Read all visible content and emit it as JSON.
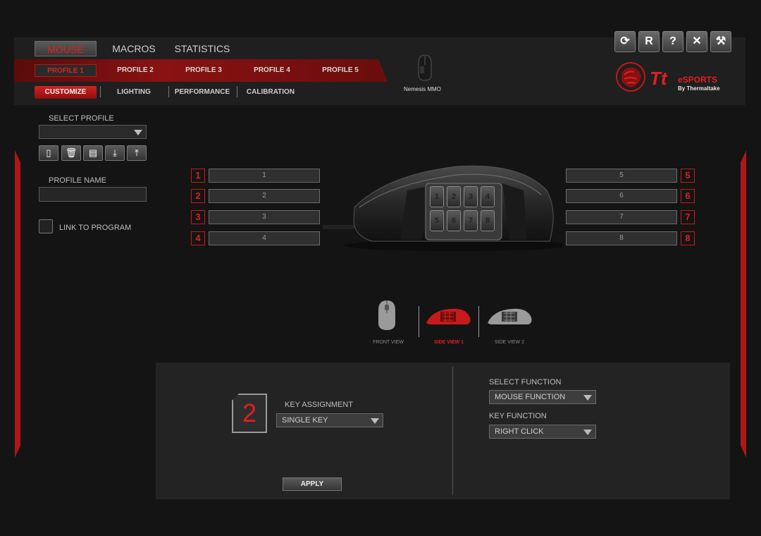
{
  "tabs": [
    "MOUSE",
    "MACROS",
    "STATISTICS"
  ],
  "profiles": [
    "PROFILE 1",
    "PROFILE 2",
    "PROFILE 3",
    "PROFILE 4",
    "PROFILE 5"
  ],
  "subtabs": [
    "CUSTOMIZE",
    "LIGHTING",
    "PERFORMANCE",
    "CALIBRATION"
  ],
  "device_name": "Nemesis MMO",
  "window_buttons": [
    "refresh",
    "reset",
    "help",
    "close",
    "settings"
  ],
  "window_button_glyphs": [
    "⟳",
    "R",
    "?",
    "✕",
    "⚒"
  ],
  "brand": {
    "tt": "Tt",
    "esports": "eSPORTS",
    "by": "By Thermaltake",
    "color": "#e02020"
  },
  "left": {
    "select_profile_label": "SELECT PROFILE",
    "select_profile_value": "",
    "profile_name_label": "PROFILE NAME",
    "profile_name_value": "",
    "link_label": "LINK TO PROGRAM",
    "actions": [
      "save",
      "delete",
      "copy",
      "import",
      "export"
    ],
    "action_glyphs": [
      "▯",
      "🗑",
      "▤",
      "⤓",
      "⤒"
    ]
  },
  "keys_left": [
    {
      "num": "1",
      "label": "1"
    },
    {
      "num": "2",
      "label": "2"
    },
    {
      "num": "3",
      "label": "3"
    },
    {
      "num": "4",
      "label": "4"
    }
  ],
  "keys_right": [
    {
      "num": "5",
      "label": "5"
    },
    {
      "num": "6",
      "label": "6"
    },
    {
      "num": "7",
      "label": "7"
    },
    {
      "num": "8",
      "label": "8"
    }
  ],
  "mouse_side_buttons": [
    "1",
    "2",
    "3",
    "4",
    "5",
    "6",
    "7",
    "8"
  ],
  "views": [
    "FRONT VIEW",
    "SIDE VIEW 1",
    "SIDE VIEW 2"
  ],
  "selected_view": "SIDE VIEW 1",
  "assign": {
    "selected_key": "2",
    "key_assignment_label": "KEY ASSIGNMENT",
    "key_assignment_value": "SINGLE KEY",
    "select_function_label": "SELECT FUNCTION",
    "select_function_value": "MOUSE FUNCTION",
    "key_function_label": "KEY FUNCTION",
    "key_function_value": "RIGHT CLICK",
    "apply_label": "APPLY"
  },
  "colors": {
    "accent": "#e02020",
    "background": "#141414"
  }
}
